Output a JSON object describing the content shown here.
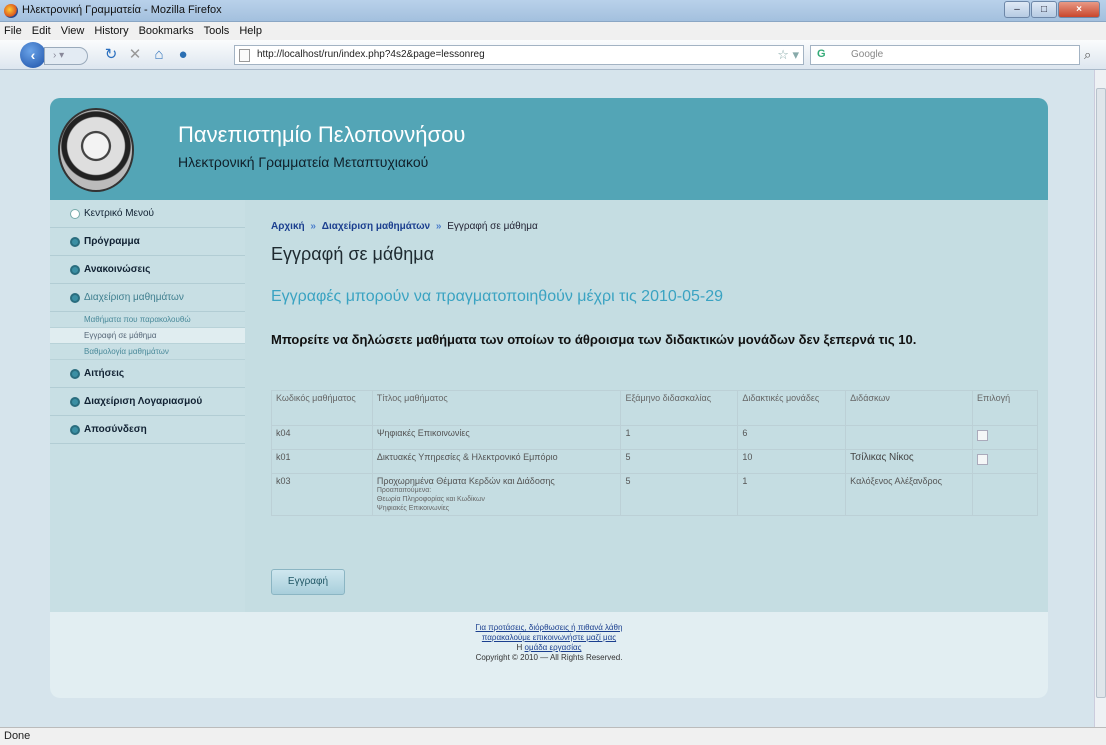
{
  "window": {
    "title": "Ηλεκτρονική Γραμματεία - Mozilla Firefox",
    "min": "–",
    "max": "□",
    "close": "×"
  },
  "menu": [
    "File",
    "Edit",
    "View",
    "History",
    "Bookmarks",
    "Tools",
    "Help"
  ],
  "toolbar": {
    "url": "http://localhost/run/index.php?4s2&page=lessonreg",
    "search_placeholder": "Google",
    "search_engine": "G"
  },
  "status": "Done",
  "site": {
    "title": "Πανεπιστημίο Πελοποννήσου",
    "subtitle": "Ηλεκτρονική Γραμματεία Μεταπτυχιακού"
  },
  "sidebar": {
    "items": [
      {
        "label": "Κεντρικό Μενού"
      },
      {
        "label": "Πρόγραμμα"
      },
      {
        "label": "Ανακοινώσεις"
      },
      {
        "label": "Διαχείριση μαθημάτων"
      },
      {
        "label": "Αιτήσεις"
      },
      {
        "label": "Διαχείριση Λογαριασμού"
      },
      {
        "label": "Αποσύνδεση"
      }
    ],
    "subitems": [
      {
        "label": "Μαθήματα που παρακολουθώ"
      },
      {
        "label": "Εγγραφή σε μάθημα"
      },
      {
        "label": "Βαθμολογία μαθημάτων"
      }
    ]
  },
  "breadcrumb": {
    "home": "Αρχική",
    "sep1": "»",
    "manage": "Διαχείριση μαθημάτων",
    "sep2": "»",
    "current": "Εγγραφή σε μάθημα"
  },
  "page_title": "Εγγραφή σε μάθημα",
  "deadline": "Εγγραφές μπορούν να πραγματοποιηθούν μέχρι τις 2010-05-29",
  "notice": "Μπορείτε να δηλώσετε μαθήματα των οποίων το άθροισμα των διδακτικών μονάδων δεν ξεπερνά τις 10.",
  "table": {
    "headers": [
      "Κωδικός μαθήματος",
      "Τίτλος μαθήματος",
      "Εξάμηνο διδασκαλίας",
      "Διδακτικές μονάδες",
      "Διδάσκων",
      "Επιλογή"
    ],
    "rows": [
      {
        "code": "k04",
        "title": "Ψηφιακές Επικοινωνίες",
        "semester": "1",
        "units": "6",
        "teacher": "",
        "prereq_label": "",
        "prereq_1": "",
        "prereq_2": ""
      },
      {
        "code": "k01",
        "title": "Δικτυακές Υπηρεσίες & Ηλεκτρονικό Εμπόριο",
        "semester": "5",
        "units": "10",
        "teacher": "Τσίλικας Νίκος",
        "prereq_label": "",
        "prereq_1": "",
        "prereq_2": ""
      },
      {
        "code": "k03",
        "title": "Προχωρημένα Θέματα Κερδών και Διάδοσης",
        "semester": "5",
        "units": "1",
        "teacher": "Καλόξενος Αλέξανδρος",
        "prereq_label": "Προαπαιτούμενα:",
        "prereq_1": "Θεωρία Πληροφορίας και Κωδίκων",
        "prereq_2": "Ψηφιακές Επικοινωνίες"
      }
    ]
  },
  "register_button": "Εγγραφή",
  "footer": {
    "line1": "Για προτάσεις, διόρθωσεις ή πιθανά λάθη",
    "line2": "παρακαλούμε επικοινωνήστε μαζί μας",
    "line3_prefix": "Η",
    "line3_link": "ομάδα εργασίας",
    "copyright": "Copyright © 2010 — All Rights Reserved."
  },
  "colors": {
    "header": "#53a5b6",
    "deadline": "#3aa3c2",
    "link": "#1b3f8f"
  }
}
